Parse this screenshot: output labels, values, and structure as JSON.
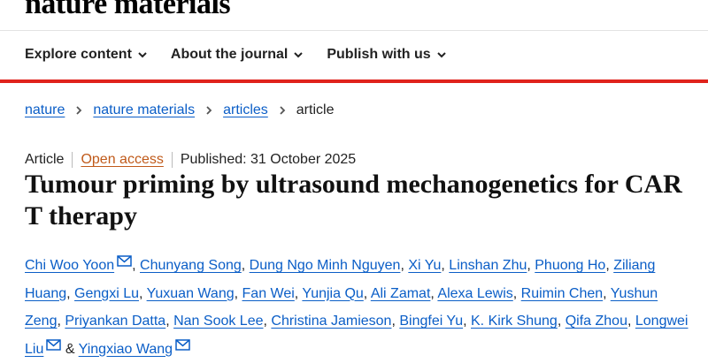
{
  "brand": {
    "logo_text": "nature materials"
  },
  "nav": {
    "items": [
      {
        "label": "Explore content"
      },
      {
        "label": "About the journal"
      },
      {
        "label": "Publish with us"
      }
    ]
  },
  "colors": {
    "accent_red": "#e0231c",
    "link_blue": "#0b5ec7",
    "open_access_orange": "#c05a1a"
  },
  "icons": {
    "nav_dropdown": "chevron-down-icon",
    "breadcrumb_separator": "chevron-right-icon",
    "corresponding_author": "mail-icon"
  },
  "breadcrumbs": {
    "items": [
      {
        "label": "nature"
      },
      {
        "label": "nature materials"
      },
      {
        "label": "articles"
      }
    ],
    "current": "article"
  },
  "article": {
    "type": "Article",
    "access": "Open access",
    "published": "Published: 31 October 2025",
    "title": "Tumour priming by ultrasound mechanogenetics for CAR T therapy",
    "authors_conjunction": "&",
    "authors": [
      {
        "name": "Chi Woo Yoon",
        "mail": true
      },
      {
        "name": "Chunyang Song"
      },
      {
        "name": "Dung Ngo Minh Nguyen"
      },
      {
        "name": "Xi Yu"
      },
      {
        "name": "Linshan Zhu"
      },
      {
        "name": "Phuong Ho"
      },
      {
        "name": "Ziliang Huang"
      },
      {
        "name": "Gengxi Lu"
      },
      {
        "name": "Yuxuan Wang"
      },
      {
        "name": "Fan Wei"
      },
      {
        "name": "Yunjia Qu"
      },
      {
        "name": "Ali Zamat"
      },
      {
        "name": "Alexa Lewis"
      },
      {
        "name": "Ruimin Chen"
      },
      {
        "name": "Yushun Zeng"
      },
      {
        "name": "Priyankan Datta"
      },
      {
        "name": "Nan Sook Lee"
      },
      {
        "name": "Christina Jamieson"
      },
      {
        "name": "Bingfei Yu"
      },
      {
        "name": "K. Kirk Shung"
      },
      {
        "name": "Qifa Zhou"
      },
      {
        "name": "Longwei Liu",
        "mail": true
      },
      {
        "name": "Yingxiao Wang",
        "mail": true
      }
    ]
  }
}
